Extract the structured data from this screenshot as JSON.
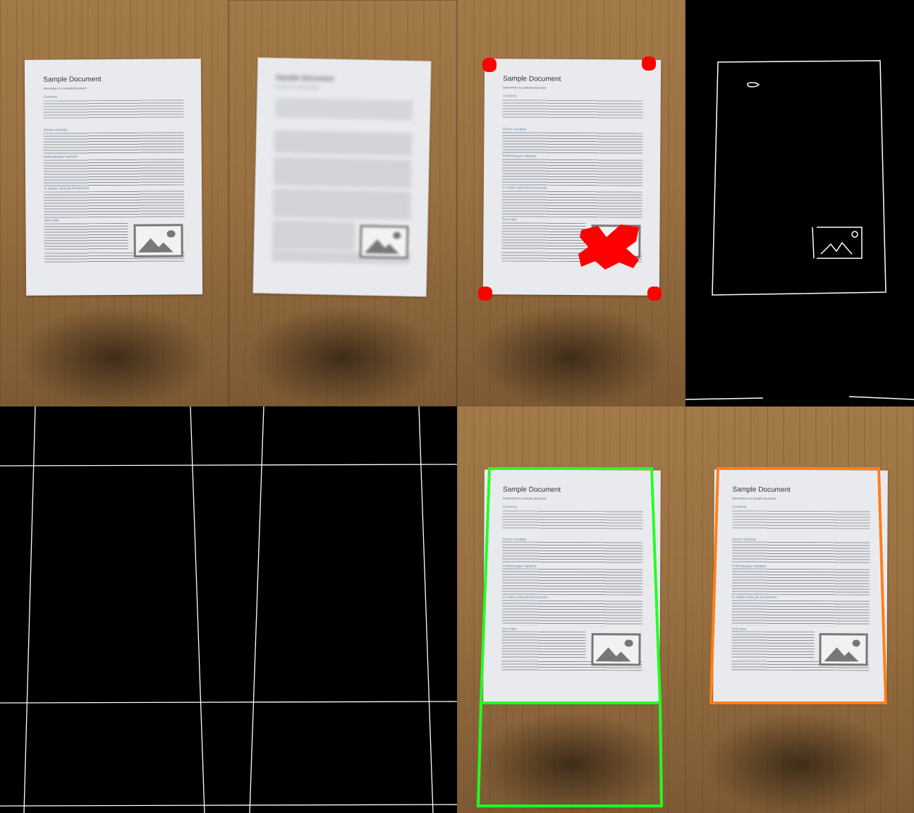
{
  "document": {
    "title": "Sample Document",
    "subtitle": "Somewhere is a sample document",
    "sections": [
      "Contents",
      "Donec volutpat",
      "Pellentesque habitant",
      "In mattis vehicula fermentum",
      "Sed vitae"
    ]
  },
  "colors": {
    "corner_marks": "#ff0000",
    "hough_lines": "#ffffff",
    "detected_quad": "#22ff22",
    "final_quad": "#ff7f1a"
  },
  "icons": [
    "image-placeholder-icon"
  ]
}
